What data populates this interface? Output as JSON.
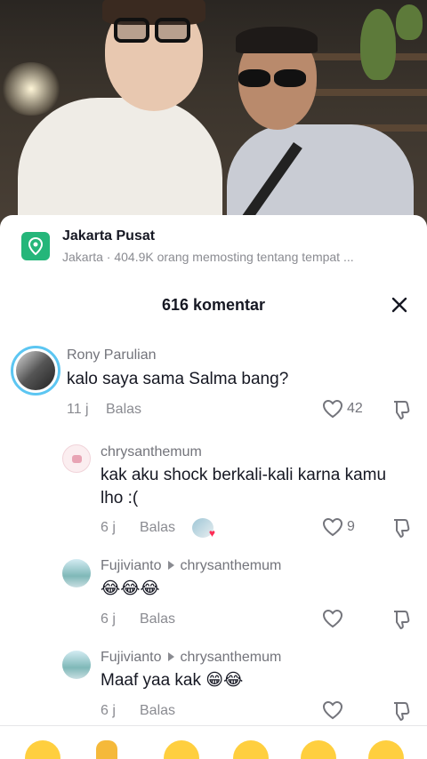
{
  "location": {
    "title": "Jakarta Pusat",
    "subtitle": "Jakarta · 404.9K orang memosting tentang tempat ..."
  },
  "comments_header": {
    "title": "616 komentar"
  },
  "comments": [
    {
      "username": "Rony Parulian",
      "text": "kalo saya sama Salma bang?",
      "time": "11 j",
      "reply_label": "Balas",
      "likes": "42"
    },
    {
      "username": "chrysanthemum",
      "text": "kak aku shock berkali-kali karna kamu lho :(",
      "time": "6 j",
      "reply_label": "Balas",
      "likes": "9"
    },
    {
      "username": "Fujivianto",
      "reply_to": "chrysanthemum",
      "text": "😂😂😂",
      "time": "6 j",
      "reply_label": "Balas"
    },
    {
      "username": "Fujivianto",
      "reply_to": "chrysanthemum",
      "text": "Maaf yaa kak 😁😂",
      "time": "6 j",
      "reply_label": "Balas"
    }
  ],
  "colors": {
    "location_icon": "#25b67a",
    "text_primary": "#161823",
    "text_secondary": "#8a8b91"
  }
}
